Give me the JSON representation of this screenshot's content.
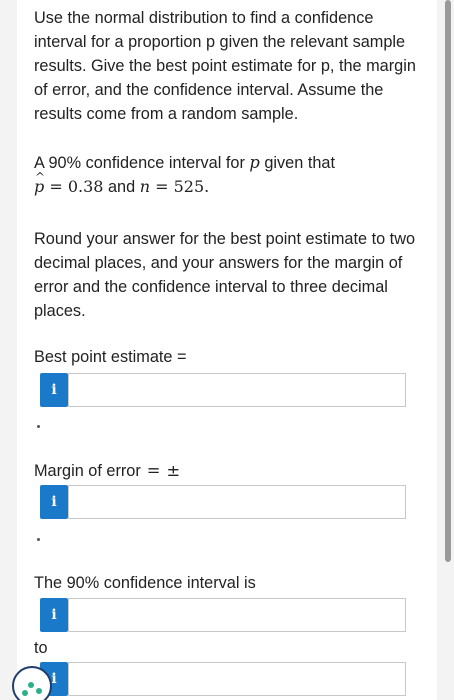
{
  "question": {
    "intro": "Use the normal distribution to find a confidence interval for a proportion p given the relevant sample results. Give the best point estimate for p, the margin of error, and the confidence interval. Assume the results come from a random sample.",
    "ci_text_prefix": "A 90% confidence interval for ",
    "ci_var": "p",
    "ci_text_mid": " given that",
    "p_hat_symbol": "p",
    "p_hat_eq": "= 0.38",
    "and_text": "and",
    "n_symbol": "n",
    "n_eq": "= 525.",
    "rounding": "Round your answer for the best point estimate to two decimal places, and your answers for the margin of error and the confidence interval to three decimal places."
  },
  "fields": {
    "best_point_label": "Best point estimate =",
    "margin_label": "Margin of error",
    "margin_eq": "=",
    "margin_pm": "±",
    "ci_label": "The 90% confidence interval is",
    "to_label": "to",
    "info_glyph": "i",
    "period": "."
  },
  "icons": {
    "info": "info-icon",
    "chat": "chat-widget-icon"
  },
  "colors": {
    "info_button": "#1a7ac9",
    "background": "#f3f3f3"
  }
}
